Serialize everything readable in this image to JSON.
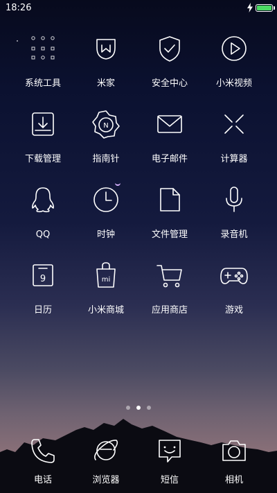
{
  "status_bar": {
    "time": "18:26",
    "battery_color": "#4cd964"
  },
  "apps": [
    {
      "label": "系统工具",
      "icon": "folder-icon"
    },
    {
      "label": "米家",
      "icon": "mijia-icon"
    },
    {
      "label": "安全中心",
      "icon": "shield-check-icon"
    },
    {
      "label": "小米视频",
      "icon": "play-icon"
    },
    {
      "label": "下载管理",
      "icon": "download-icon"
    },
    {
      "label": "指南针",
      "icon": "compass-icon"
    },
    {
      "label": "电子邮件",
      "icon": "mail-icon"
    },
    {
      "label": "计算器",
      "icon": "calculator-icon"
    },
    {
      "label": "QQ",
      "icon": "qq-icon"
    },
    {
      "label": "时钟",
      "icon": "clock-icon"
    },
    {
      "label": "文件管理",
      "icon": "file-icon"
    },
    {
      "label": "录音机",
      "icon": "microphone-icon"
    },
    {
      "label": "日历",
      "icon": "calendar-icon"
    },
    {
      "label": "小米商城",
      "icon": "shopping-bag-icon"
    },
    {
      "label": "应用商店",
      "icon": "cart-icon"
    },
    {
      "label": "游戏",
      "icon": "gamepad-icon"
    }
  ],
  "icon_glyphs": {
    "compass_letter": "N",
    "calendar_day": "9",
    "mi_mark": "mi"
  },
  "page_indicator": {
    "count": 3,
    "active_index": 1
  },
  "dock": [
    {
      "label": "电话",
      "icon": "phone-icon"
    },
    {
      "label": "浏览器",
      "icon": "browser-icon"
    },
    {
      "label": "短信",
      "icon": "message-icon"
    },
    {
      "label": "相机",
      "icon": "camera-icon"
    }
  ]
}
